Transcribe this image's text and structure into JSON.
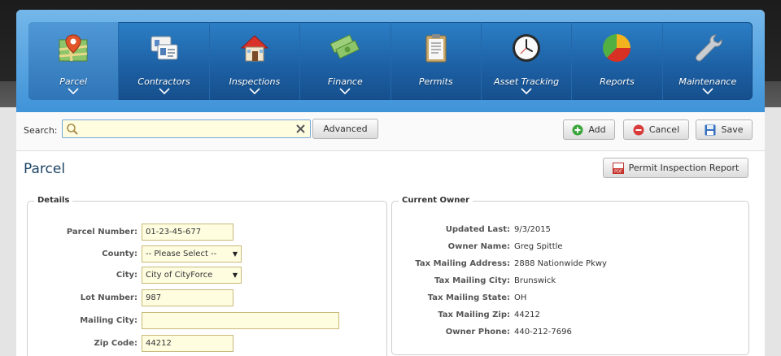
{
  "nav": {
    "items": [
      {
        "label": "Parcel",
        "icon": "map-pin-icon",
        "active": true,
        "chevron": true
      },
      {
        "label": "Contractors",
        "icon": "id-card-icon",
        "chevron": true
      },
      {
        "label": "Inspections",
        "icon": "house-icon",
        "chevron": true
      },
      {
        "label": "Finance",
        "icon": "money-icon",
        "chevron": true
      },
      {
        "label": "Permits",
        "icon": "clipboard-icon",
        "chevron": false
      },
      {
        "label": "Asset Tracking",
        "icon": "clock-icon",
        "chevron": true
      },
      {
        "label": "Reports",
        "icon": "pie-chart-icon",
        "chevron": false
      },
      {
        "label": "Maintenance",
        "icon": "wrench-icon",
        "chevron": true
      }
    ]
  },
  "toolbar": {
    "search_label": "Search:",
    "search_value": "",
    "advanced_label": "Advanced",
    "add_label": "Add",
    "cancel_label": "Cancel",
    "save_label": "Save"
  },
  "page": {
    "title": "Parcel",
    "report_button_label": "Permit Inspection Report"
  },
  "details": {
    "legend": "Details",
    "parcel_number_label": "Parcel Number:",
    "parcel_number": "01-23-45-677",
    "county_label": "County:",
    "county_value": "-- Please Select --",
    "city_label": "City:",
    "city_value": "City of CityForce",
    "lot_number_label": "Lot Number:",
    "lot_number": "987",
    "mailing_city_label": "Mailing City:",
    "mailing_city": "",
    "zip_code_label": "Zip Code:",
    "zip_code": "44212"
  },
  "owner": {
    "legend": "Current Owner",
    "rows": [
      {
        "label": "Updated Last:",
        "value": "9/3/2015"
      },
      {
        "label": "Owner Name:",
        "value": "Greg Spittle"
      },
      {
        "label": "Tax Mailing Address:",
        "value": "2888 Nationwide Pkwy"
      },
      {
        "label": "Tax Mailing City:",
        "value": "Brunswick"
      },
      {
        "label": "Tax Mailing State:",
        "value": "OH"
      },
      {
        "label": "Tax Mailing Zip:",
        "value": "44212"
      },
      {
        "label": "Owner Phone:",
        "value": "440-212-7696"
      }
    ]
  },
  "colors": {
    "nav_bg": "#1c5fa3",
    "nav_frame": "#4a9be0",
    "field_bg": "#fffde0",
    "title": "#1d4566",
    "add_green": "#3aa53a",
    "cancel_red": "#d93a3a",
    "save_blue": "#3570c0"
  }
}
